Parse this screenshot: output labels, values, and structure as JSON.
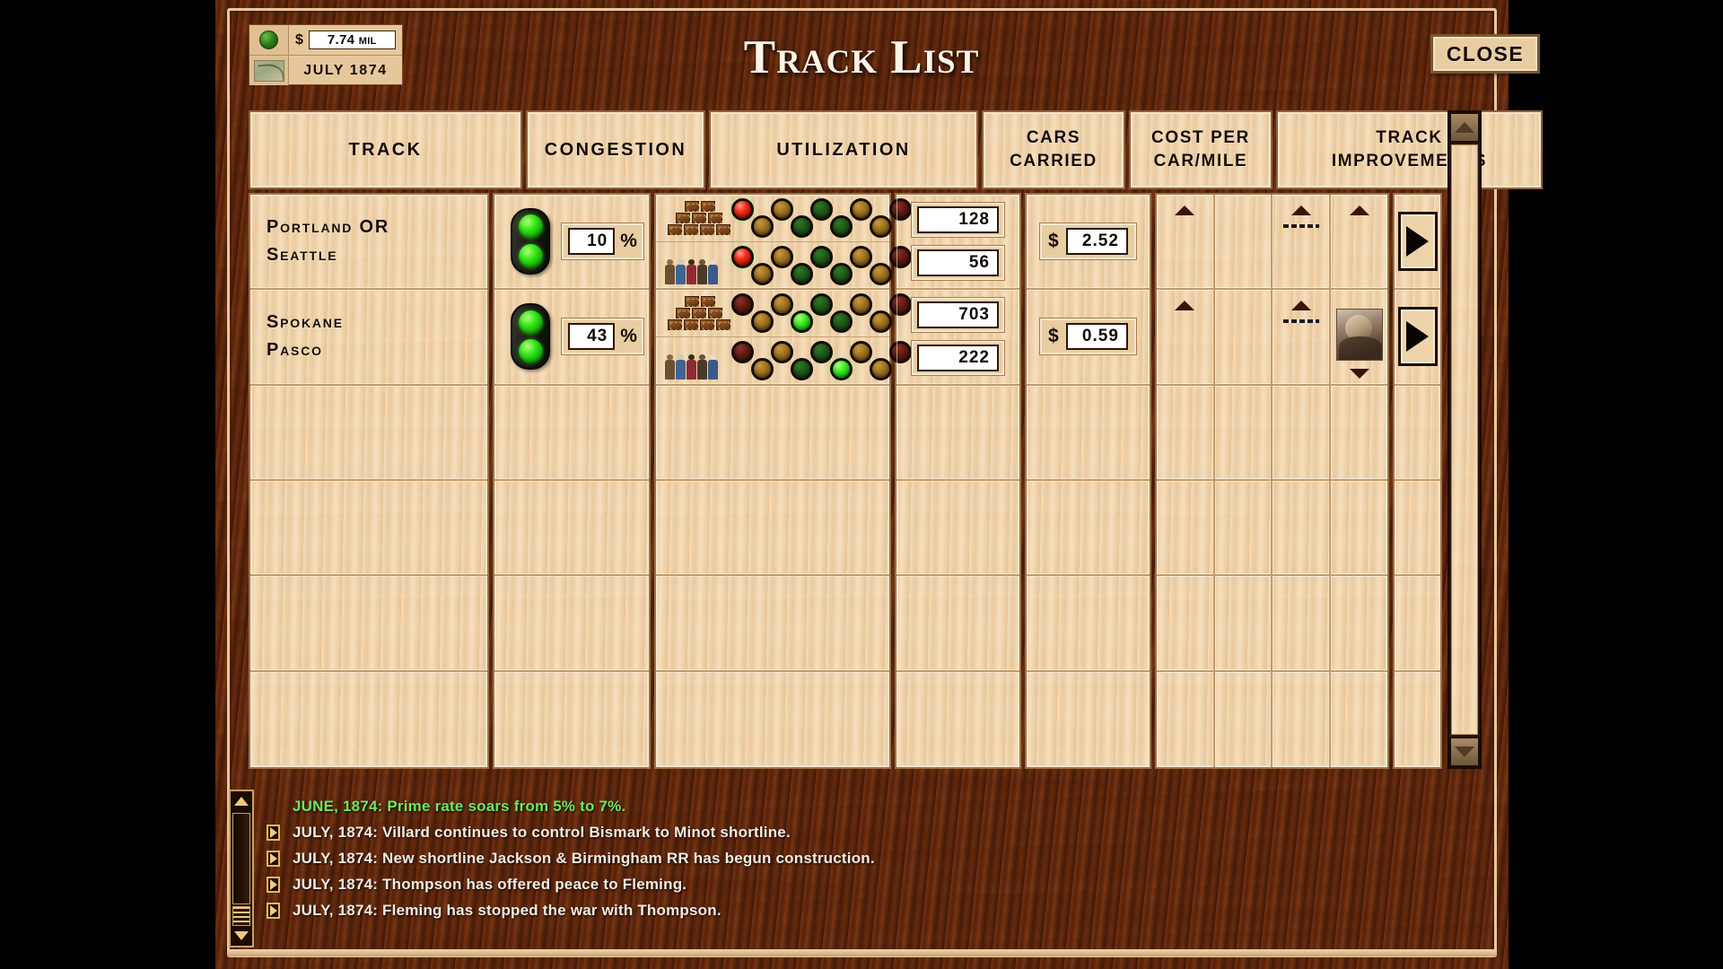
{
  "window": {
    "title": "Track List",
    "close_label": "CLOSE"
  },
  "status": {
    "money_icon": "green-sphere-icon",
    "currency_symbol": "$",
    "money_value": "7.74",
    "money_unit": "MIL",
    "map_icon": "map-thumbnail-icon",
    "date": "JULY 1874"
  },
  "table": {
    "columns": [
      {
        "label": "TRACK"
      },
      {
        "label": "CONGESTION"
      },
      {
        "label": "UTILIZATION"
      },
      {
        "label": "CARS\nCARRIED",
        "line1": "CARS",
        "line2": "CARRIED"
      },
      {
        "label": "COST PER\nCAR/MILE",
        "line1": "COST PER",
        "line2": "CAR/MILE"
      },
      {
        "label": "TRACK\nIMPROVEMENTS",
        "line1": "TRACK",
        "line2": "IMPROVEMENTS"
      }
    ],
    "rows": [
      {
        "track_line1": "Portland  OR",
        "track_line2": "Seattle",
        "congestion_pct": "10",
        "congestion_unit": "%",
        "congestion_signal": "green-green",
        "utilization": [
          {
            "cargo": "freight-crates-icon",
            "dots": [
              {
                "pos": "top",
                "state": "red-lit"
              },
              {
                "pos": "bot",
                "state": "amber-dark"
              },
              {
                "pos": "top",
                "state": "amber-dark"
              },
              {
                "pos": "bot",
                "state": "green-dark"
              },
              {
                "pos": "top",
                "state": "green-dark"
              },
              {
                "pos": "bot",
                "state": "green-dark"
              },
              {
                "pos": "top",
                "state": "amber-dark"
              },
              {
                "pos": "bot",
                "state": "amber-dark"
              },
              {
                "pos": "top",
                "state": "red-dark"
              }
            ]
          },
          {
            "cargo": "passengers-icon",
            "dots": [
              {
                "pos": "top",
                "state": "red-lit"
              },
              {
                "pos": "bot",
                "state": "amber-dark"
              },
              {
                "pos": "top",
                "state": "amber-dark"
              },
              {
                "pos": "bot",
                "state": "green-dark"
              },
              {
                "pos": "top",
                "state": "green-dark"
              },
              {
                "pos": "bot",
                "state": "green-dark"
              },
              {
                "pos": "top",
                "state": "amber-dark"
              },
              {
                "pos": "bot",
                "state": "amber-dark"
              },
              {
                "pos": "top",
                "state": "red-dark"
              }
            ]
          }
        ],
        "cars_carried": [
          "128",
          "56"
        ],
        "cost_symbol": "$",
        "cost_per_car_mile": "2.52",
        "improvements": [
          {
            "up": true,
            "dash": false,
            "portrait": false,
            "down": false
          },
          {
            "up": false,
            "dash": false,
            "portrait": false,
            "down": false
          },
          {
            "up": true,
            "dash": true,
            "portrait": false,
            "down": false
          },
          {
            "up": true,
            "dash": false,
            "portrait": false,
            "down": false
          }
        ],
        "detail_arrow": "play-arrow-icon"
      },
      {
        "track_line1": "Spokane",
        "track_line2": "Pasco",
        "congestion_pct": "43",
        "congestion_unit": "%",
        "congestion_signal": "green-green",
        "utilization": [
          {
            "cargo": "freight-crates-icon",
            "dots": [
              {
                "pos": "top",
                "state": "red-dark"
              },
              {
                "pos": "bot",
                "state": "amber-dark"
              },
              {
                "pos": "top",
                "state": "amber-dark"
              },
              {
                "pos": "bot",
                "state": "green-lit"
              },
              {
                "pos": "top",
                "state": "green-dark"
              },
              {
                "pos": "bot",
                "state": "green-dark"
              },
              {
                "pos": "top",
                "state": "amber-dark"
              },
              {
                "pos": "bot",
                "state": "amber-dark"
              },
              {
                "pos": "top",
                "state": "red-dark"
              }
            ]
          },
          {
            "cargo": "passengers-icon",
            "dots": [
              {
                "pos": "top",
                "state": "red-dark"
              },
              {
                "pos": "bot",
                "state": "amber-dark"
              },
              {
                "pos": "top",
                "state": "amber-dark"
              },
              {
                "pos": "bot",
                "state": "green-dark"
              },
              {
                "pos": "top",
                "state": "green-dark"
              },
              {
                "pos": "bot",
                "state": "green-lit"
              },
              {
                "pos": "top",
                "state": "amber-dark"
              },
              {
                "pos": "bot",
                "state": "amber-dark"
              },
              {
                "pos": "top",
                "state": "red-dark"
              }
            ]
          }
        ],
        "cars_carried": [
          "703",
          "222"
        ],
        "cost_symbol": "$",
        "cost_per_car_mile": "0.59",
        "improvements": [
          {
            "up": true,
            "dash": false,
            "portrait": false,
            "down": false
          },
          {
            "up": false,
            "dash": false,
            "portrait": false,
            "down": false
          },
          {
            "up": true,
            "dash": true,
            "portrait": false,
            "down": false
          },
          {
            "up": false,
            "dash": false,
            "portrait": true,
            "down": true
          }
        ],
        "detail_arrow": "play-arrow-icon"
      },
      {
        "empty": true
      },
      {
        "empty": true
      },
      {
        "empty": true
      },
      {
        "empty": true
      }
    ]
  },
  "news": {
    "items": [
      {
        "text": "JUNE, 1874: Prime rate soars from 5% to 7%.",
        "highlight": true,
        "bullet": false
      },
      {
        "text": "JULY, 1874: Villard continues to control Bismark to Minot shortline.",
        "highlight": false,
        "bullet": true
      },
      {
        "text": "JULY, 1874: New shortline Jackson & Birmingham RR has begun construction.",
        "highlight": false,
        "bullet": true
      },
      {
        "text": "JULY, 1874: Thompson has offered peace to Fleming.",
        "highlight": false,
        "bullet": true
      },
      {
        "text": "JULY, 1874: Fleming has stopped the war with Thompson.",
        "highlight": false,
        "bullet": true
      }
    ]
  },
  "colors": {
    "wood_dark": "#4a1f0c",
    "wood_light": "#edcfa3",
    "panel_border": "#e8c89c",
    "signal_green": "#35e61a",
    "news_highlight": "#6ee85a",
    "text_dark": "#140b04"
  },
  "dot_palette": {
    "red-lit": "radial-gradient(circle at 35% 28%, #ff9b8a 0%, #f42c18 38%, #a81006 78%, #5d0602 100%)",
    "red-dark": "radial-gradient(circle at 35% 28%, #8d3228 0%, #5e1a12 45%, #3a0d07 100%)",
    "amber-dark": "radial-gradient(circle at 35% 28%, #c89a3c 0%, #9a6f1e 45%, #5c4010 100%)",
    "green-dark": "radial-gradient(circle at 35% 28%, #2e7a26 0%, #1b5417 48%, #0d3009 100%)",
    "green-lit": "radial-gradient(circle at 35% 28%, #b8ff86 0%, #3cf024 36%, #12b008 74%, #075c03 100%)"
  }
}
